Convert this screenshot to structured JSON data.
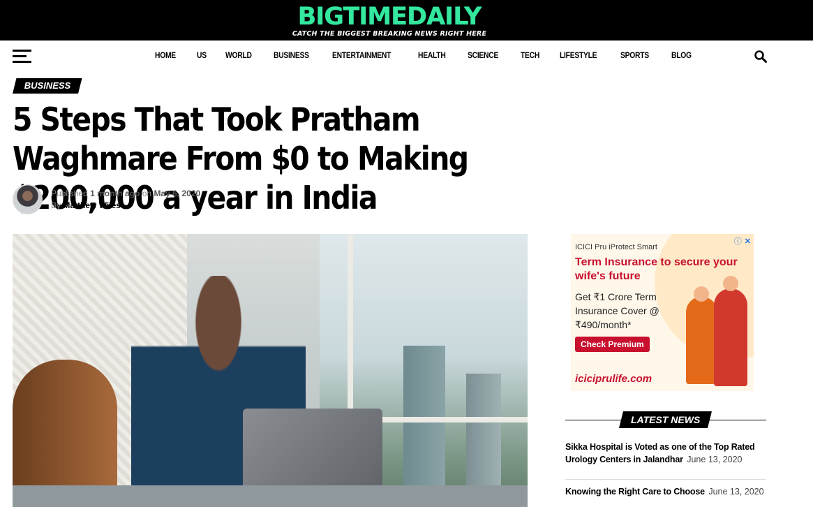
{
  "site": {
    "logo_main_1": "BIGTIME",
    "logo_main_2": "DAILY",
    "tagline": "CATCH THE BIGGEST BREAKING NEWS RIGHT HERE",
    "accent": "#34e89e"
  },
  "nav": {
    "items": [
      "HOME",
      "US",
      "WORLD",
      "BUSINESS",
      "ENTERTAINMENT",
      "HEALTH",
      "SCIENCE",
      "TECH",
      "LIFESTYLE",
      "SPORTS",
      "BLOG"
    ],
    "menu_icon": "hamburger-icon",
    "search_icon": "search-icon"
  },
  "article": {
    "category": "BUSINESS",
    "title": "5 Steps That Took Pratham Waghmare From $0 to Making $200,000 a year in India",
    "published_prefix": "Published",
    "published_relative": "1 month ago",
    "published_on": "on",
    "published_date": "May 6, 2020",
    "by": "By",
    "author": "Matthew Wiles"
  },
  "ad": {
    "brand": "ICICI Pru iProtect Smart",
    "headline": "Term Insurance to secure your wife's future",
    "sub": "Get ₹1 Crore Term Insurance Cover @ ₹490/month*",
    "cta": "Check Premium",
    "url": "iciciprulife.com",
    "info_icon": "ⓘ",
    "close_icon": "✕"
  },
  "sidebar": {
    "latest_label": "LATEST NEWS",
    "news": [
      {
        "title": "Sikka Hospital is Voted as one of the Top Rated Urology Centers in Jalandhar",
        "date": "June 13, 2020"
      },
      {
        "title": "Knowing the Right Care to Choose",
        "date": "June 13, 2020"
      }
    ]
  }
}
